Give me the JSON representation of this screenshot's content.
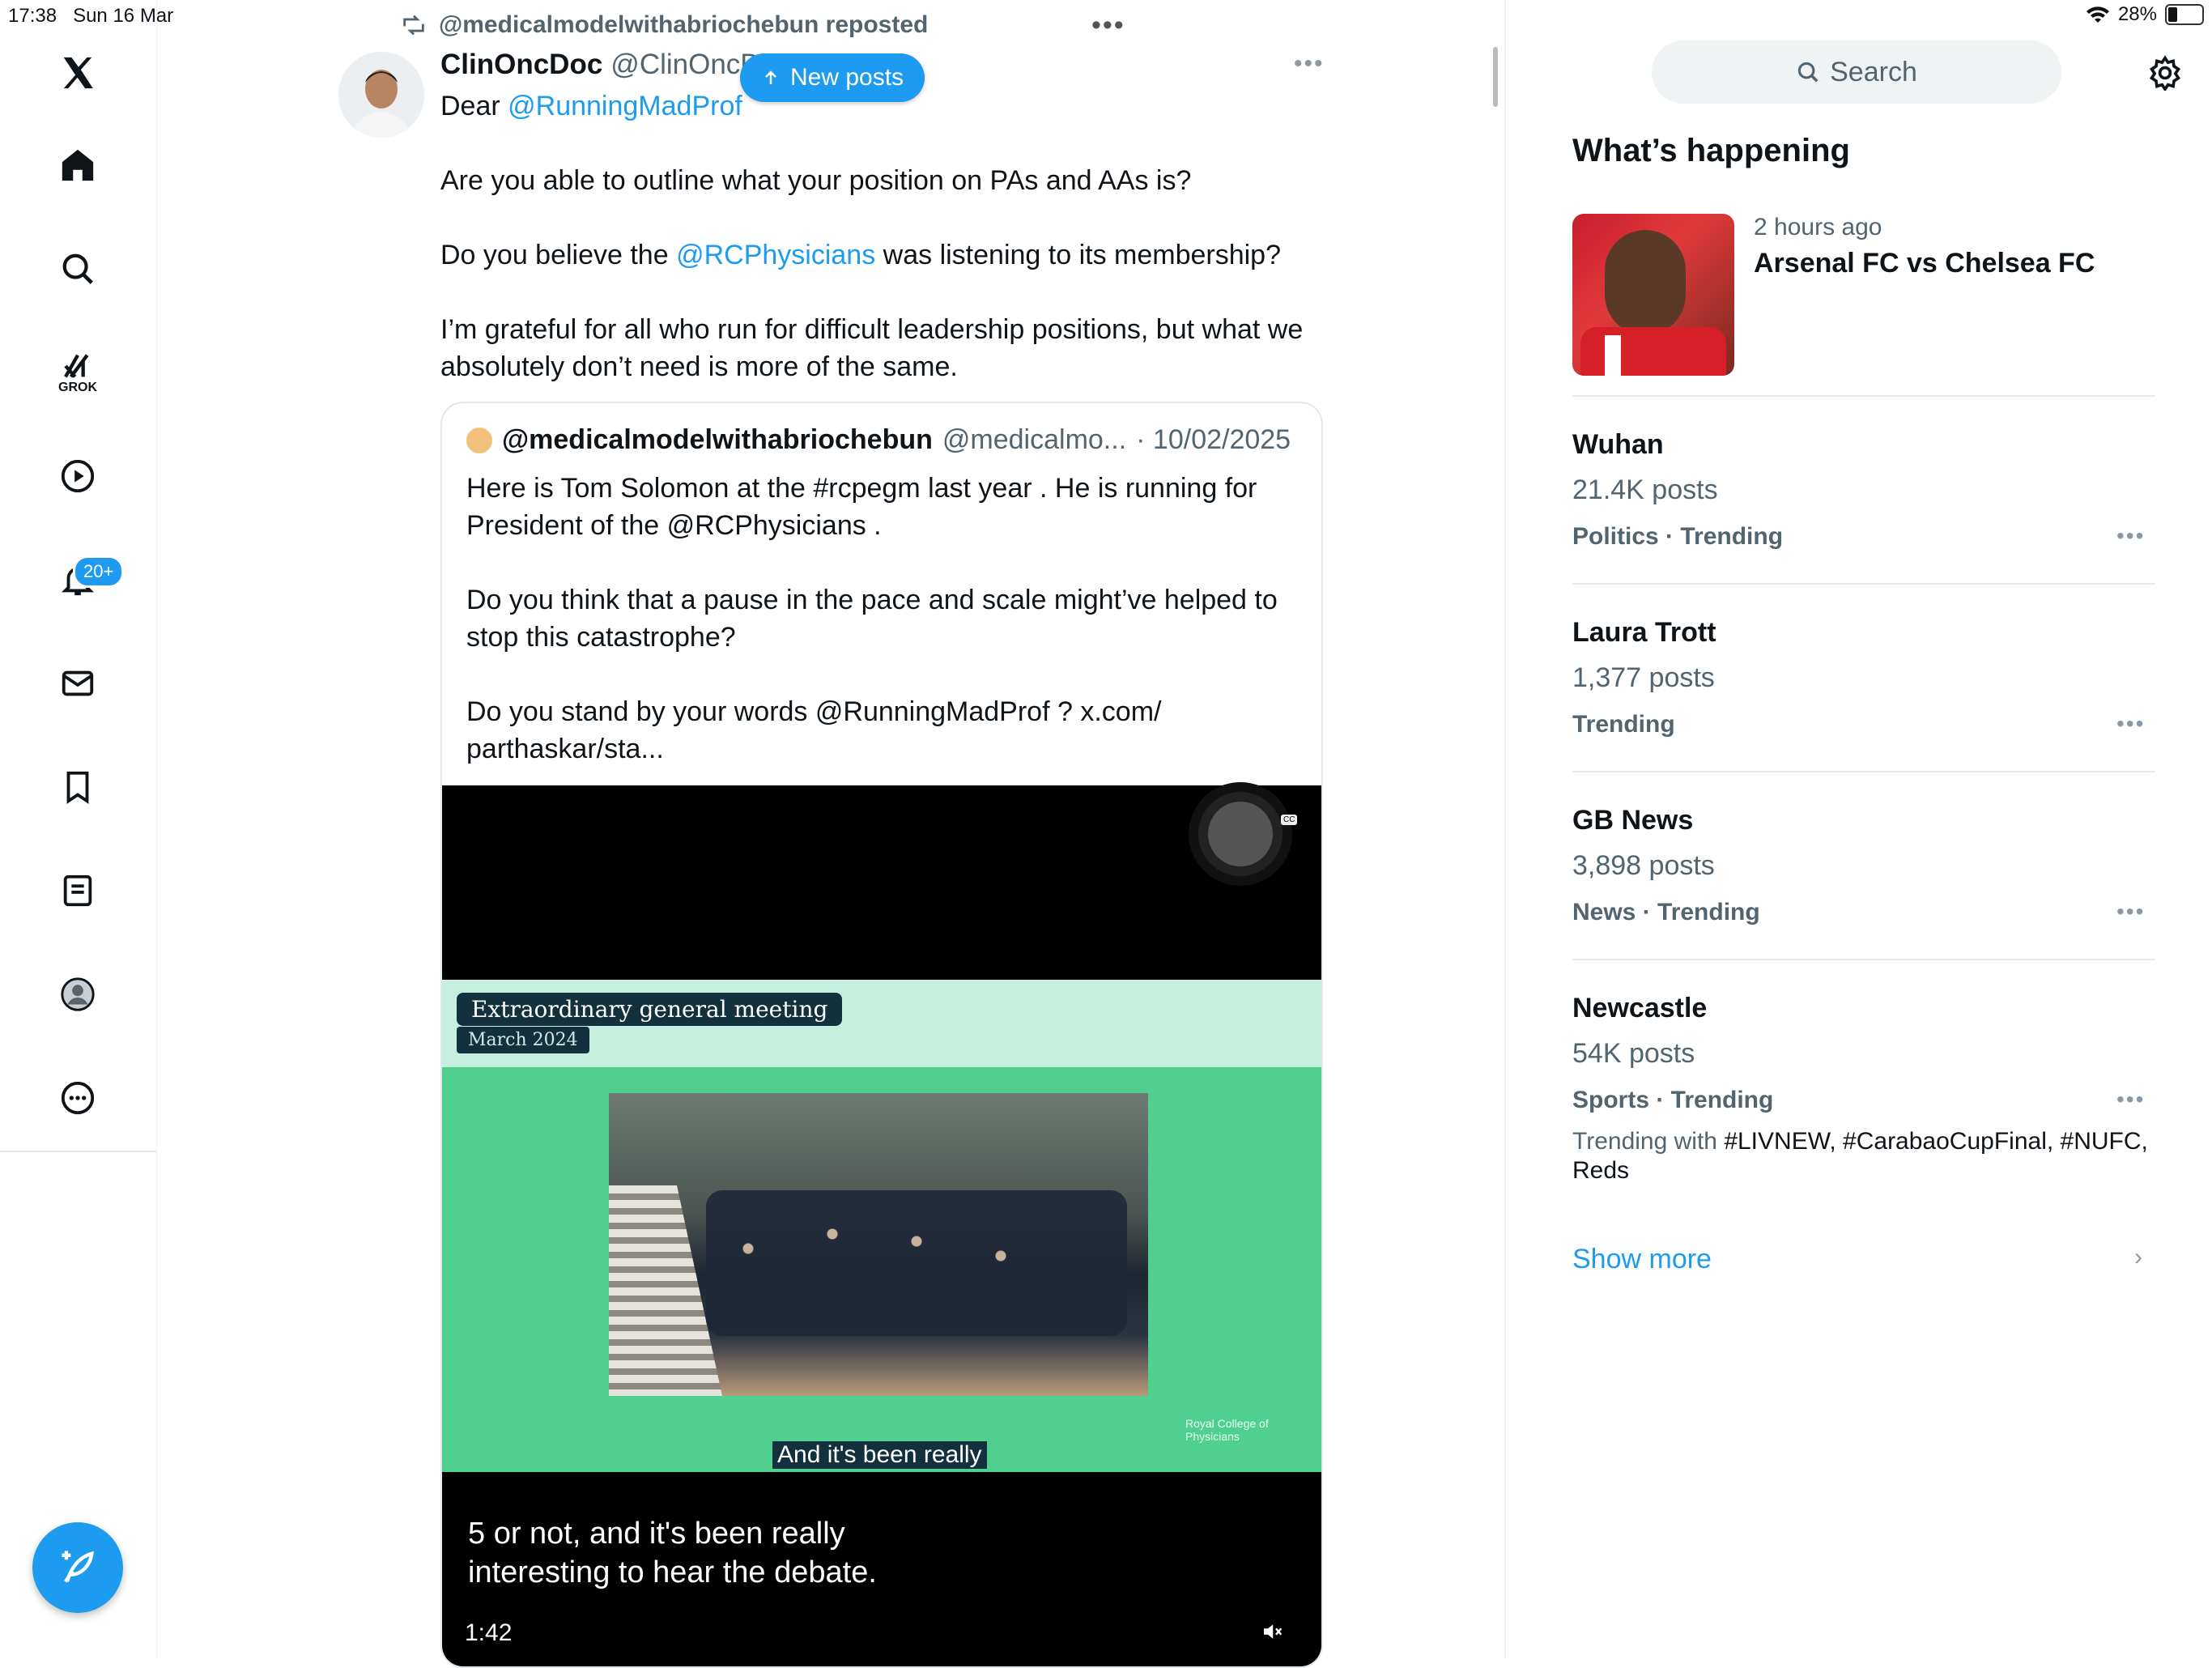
{
  "status": {
    "time": "17:38",
    "date": "Sun 16 Mar",
    "battery": "28%"
  },
  "nav": {
    "badge": "20+",
    "grok_label": "GROK"
  },
  "post": {
    "repost_label": "@medicalmodelwithabriochebun reposted",
    "author_name": "ClinOncDoc",
    "author_handle": "@ClinOncD",
    "new_posts": "New posts",
    "line1_prefix": "Dear ",
    "line1_mention": "@RunningMadProf",
    "para1": "Are you able to outline what your position on PAs and AAs is?",
    "para2_prefix": "Do you believe the ",
    "para2_mention": "@RCPhysicians",
    "para2_suffix": " was listening to its membership?",
    "para3": "I’m grateful for all who run for difficult leadership positions, but what we absolutely don’t need is more of the same."
  },
  "quote": {
    "name": "@medicalmodelwithabriochebun",
    "handle": "@medicalmo...",
    "date": "· 10/02/2025",
    "para1": "Here is Tom Solomon at the #rcpegm last year . He is running for President of the @RCPhysicians .",
    "para2": "Do you think that a pause in the pace and scale might’ve helped to stop this catastrophe?",
    "para3": "Do you stand by your words @RunningMadProf ? x.com/ parthaskar/sta..."
  },
  "video": {
    "title": "Extraordinary general meeting",
    "subtitle": "March 2024",
    "inline_caption": "And it's been really",
    "caption": "5 or not, and it's been really interesting to hear the debate.",
    "time": "1:42",
    "logo_text": "Royal College of Physicians",
    "cc": "CC"
  },
  "sidebar": {
    "search_placeholder": "Search",
    "whats_happening": "What’s happening",
    "featured": {
      "time": "2 hours ago",
      "title": "Arsenal FC vs Chelsea FC"
    },
    "trends": [
      {
        "name": "Wuhan",
        "count": "21.4K posts",
        "category": "Politics · Trending"
      },
      {
        "name": "Laura Trott",
        "count": "1,377 posts",
        "category": "Trending"
      },
      {
        "name": "GB News",
        "count": "3,898 posts",
        "category": "News · Trending"
      },
      {
        "name": "Newcastle",
        "count": "54K posts",
        "category": "Sports · Trending",
        "with_label": "Trending with ",
        "with_tags": "#LIVNEW, #CarabaoCupFinal, #NUFC, Reds"
      }
    ],
    "show_more": "Show more"
  },
  "colors": {
    "accent": "#1d9bf0",
    "text": "#0f1419",
    "muted": "#536471"
  }
}
